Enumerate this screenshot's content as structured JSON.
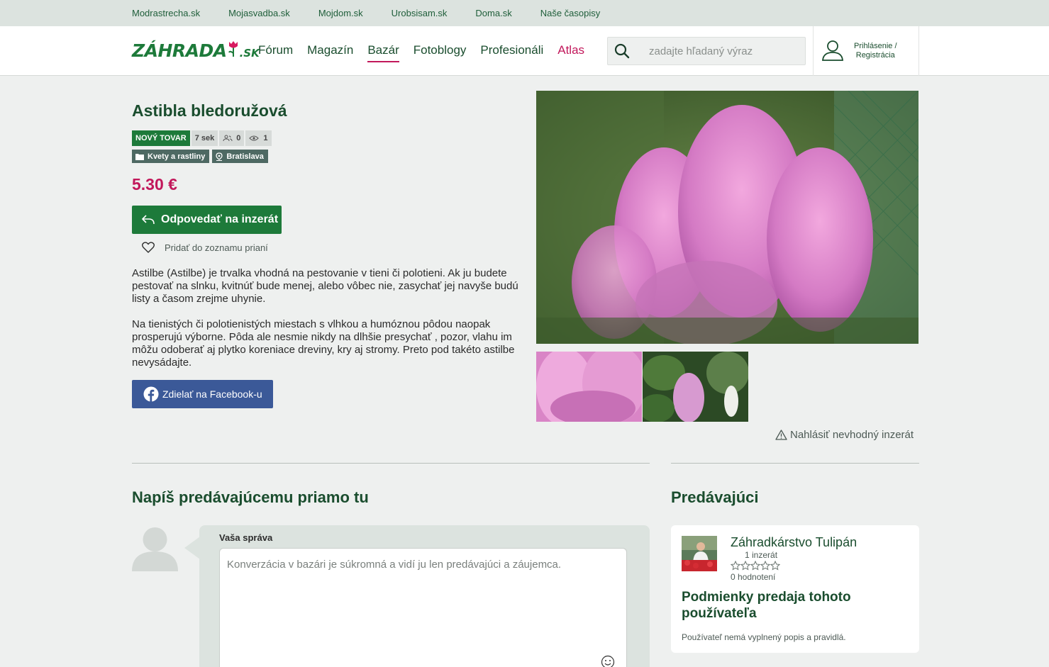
{
  "topbar": {
    "links": [
      "Modrastrecha.sk",
      "Mojasvadba.sk",
      "Mojdom.sk",
      "Urobsisam.sk",
      "Doma.sk",
      "Naše časopisy"
    ]
  },
  "header": {
    "logo_text": "ZÁHRADA",
    "logo_tld": ".SK",
    "nav": [
      {
        "label": "Fórum",
        "active": false
      },
      {
        "label": "Magazín",
        "active": false
      },
      {
        "label": "Bazár",
        "active": true
      },
      {
        "label": "Fotoblogy",
        "active": false
      },
      {
        "label": "Profesionáli",
        "active": false
      },
      {
        "label": "Atlas",
        "active": false
      }
    ],
    "search_placeholder": "zadajte hľadaný výraz",
    "login_line1": "Prihlásenie /",
    "login_line2": "Registrácia"
  },
  "listing": {
    "title": "Astibla bledoružová",
    "badge_new": "NOVÝ TOVAR",
    "age": "7 sek",
    "followers": "0",
    "views": "1",
    "category": "Kvety a rastliny",
    "location": "Bratislava",
    "price": "5.30 €",
    "reply_label": "Odpovedať na inzerát",
    "wishlist_label": "Pridať do zoznamu prianí",
    "description": [
      "Astilbe (Astilbe) je trvalka vhodná na pestovanie v tieni či polotieni. Ak ju budete pestovať na slnku, kvitnúť bude menej, alebo vôbec nie, zasychať jej navyše budú listy a časom zrejme uhynie.",
      "Na tienistých či polotienistých miestach s vlhkou a humóznou pôdou naopak prosperujú výborne. Pôda ale nesmie nikdy na dlhšie presychať , pozor, vlahu im môžu odoberať aj plytko koreniace dreviny, kry aj stromy. Preto pod takéto astilbe nevysádajte."
    ],
    "share_label": "Zdielať na Facebook-u",
    "report_label": "Nahlásiť nevhodný inzerát"
  },
  "message": {
    "heading": "Napíš predávajúcemu priamo tu",
    "label": "Vaša správa",
    "placeholder": "Konverzácia v bazári je súkromná a vidí ju len predávajúci a záujemca."
  },
  "seller": {
    "heading": "Predávajúci",
    "name": "Záhradkárstvo Tulipán",
    "listings": "1 inzerát",
    "rating_count": "0 hodnotení",
    "rating_value": 0,
    "terms_title": "Podmienky predaja tohoto používateľa",
    "terms_text": "Používateľ nemá vyplnený popis a pravidlá."
  },
  "colors": {
    "brand_green": "#1d7a3a",
    "accent_pink": "#c2185b",
    "facebook_blue": "#3b5998"
  }
}
